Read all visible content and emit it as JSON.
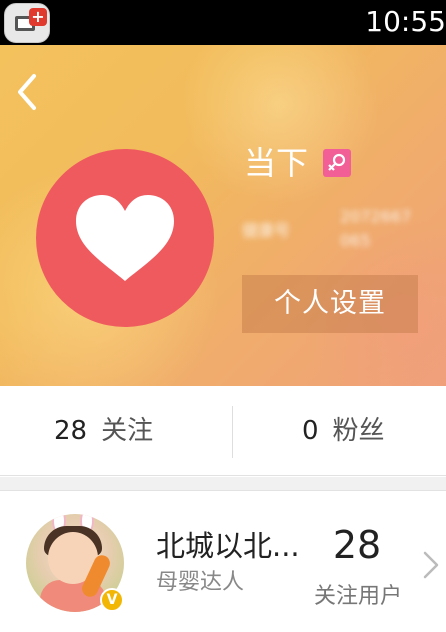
{
  "status_bar": {
    "time": "10:55",
    "app_icon": "tv-plus-app-icon"
  },
  "profile_header": {
    "back_icon": "chevron-left-icon",
    "avatar_icon": "heart-icon",
    "username": "当下",
    "gender_icon": "female-icon",
    "health_id_label": "健康号",
    "health_id_value": "2072667065",
    "settings_button_label": "个人设置",
    "accent_color": "#ef5a5f"
  },
  "stats": {
    "following_count": "28",
    "following_label": "关注",
    "fans_count": "0",
    "fans_label": "粉丝"
  },
  "user_card": {
    "name": "北城以北...",
    "description": "母婴达人",
    "follow_count": "28",
    "follow_count_label": "关注用户",
    "badge_label": "V",
    "chevron_icon": "chevron-right-icon"
  }
}
